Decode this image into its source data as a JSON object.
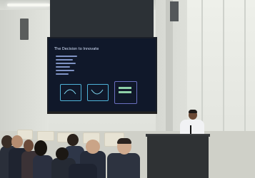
{
  "scene": {
    "description_free": true,
    "slide": {
      "title": "The Decision to Innovate"
    },
    "colors": {
      "screen_bg": "#10182a",
      "slide_accent": "#4fb3d9",
      "podium": "#2f3234",
      "presenter_shirt": "#f1f2f4"
    }
  }
}
